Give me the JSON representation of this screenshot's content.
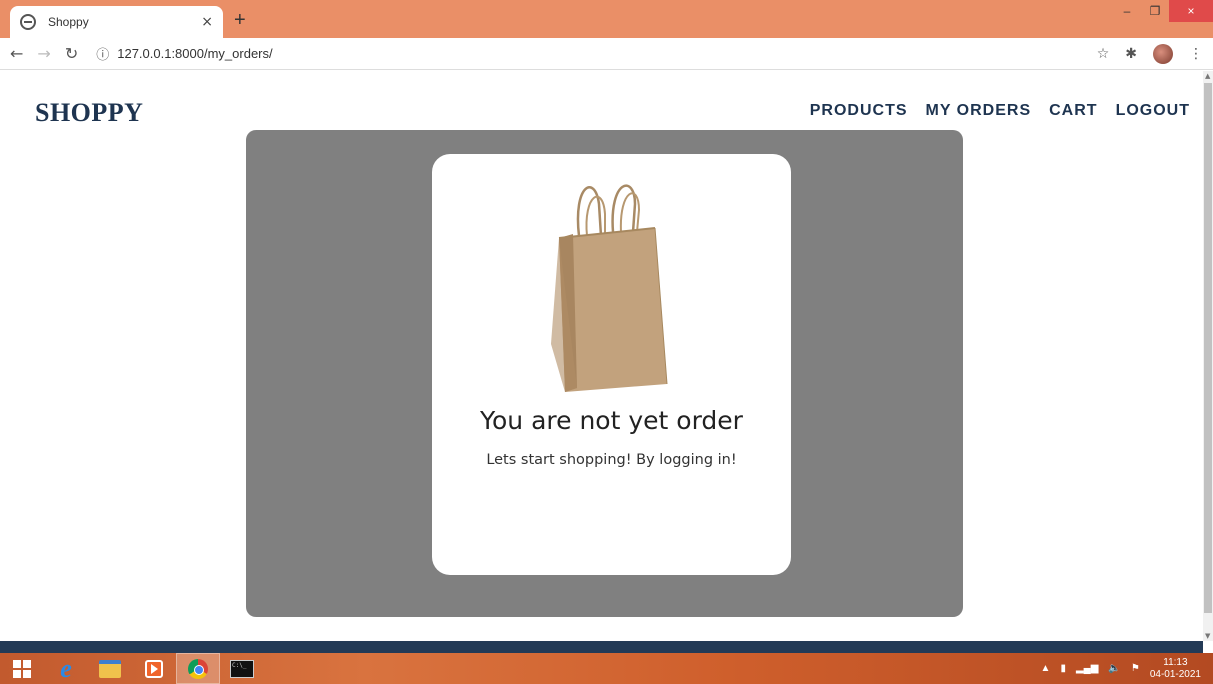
{
  "browser": {
    "tab_title": "Shoppy",
    "tab_close": "×",
    "new_tab": "+",
    "url": "127.0.0.1:8000/my_orders/",
    "window_minimize": "–",
    "window_restore": "❐",
    "window_close": "×"
  },
  "site": {
    "brand": "SHOPPY",
    "nav": [
      "PRODUCTS",
      "MY ORDERS",
      "CART",
      "LOGOUT"
    ]
  },
  "empty_state": {
    "heading": "You are not yet order",
    "message": "Lets start shopping! By logging in!",
    "image_icon": "shopping-bag-icon"
  },
  "taskbar": {
    "time": "11:13",
    "date": "04-01-2021"
  },
  "colors": {
    "tabstrip": "#ea8f67",
    "brand": "#1e3450",
    "panel": "#808080",
    "footer": "#233a56"
  }
}
